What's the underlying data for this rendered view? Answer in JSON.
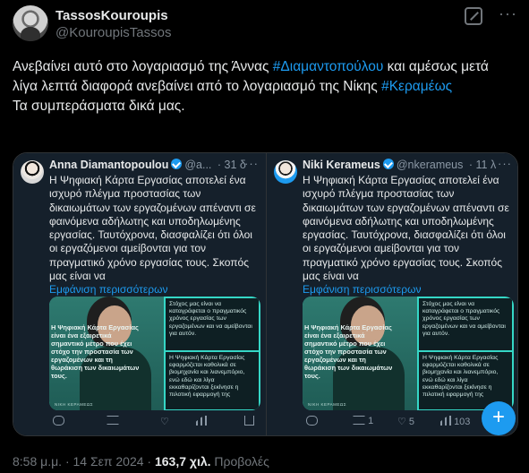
{
  "author": {
    "name": "TassosKouroupis",
    "handle": "@KouroupisTassos"
  },
  "tweet": {
    "text_1": "Ανεβαίνει αυτό στο λογαριασμό της Άννας ",
    "hashtag_1": "#Διαμαντοπούλου",
    "text_2": " και αμέσως μετά λίγα λεπτά διαφορά ανεβαίνει από το λογαριασμό της Νίκης ",
    "hashtag_2": "#Κεραμέως",
    "text_3": "Τα συμπεράσματα δικά μας."
  },
  "cards": [
    {
      "name": "Anna Diamantopoulou",
      "handle": "@a...",
      "time": "· 31 δ",
      "text": "Η Ψηφιακή Κάρτα Εργασίας αποτελεί ένα ισχυρό πλέγμα προστασίας των δικαιωμάτων των εργαζομένων απέναντι σε φαινόμενα αδήλωτης και υποδηλωμένης εργασίας. Ταυτόχρονα, διασφαλίζει ότι όλοι οι εργαζόμενοι αμείβονται για τον πραγματικό χρόνο εργασίας τους. Σκοπός μας είναι να",
      "show_more": "Εμφάνιση περισσότερων",
      "poster_overlay": "Η Ψηφιακή Κάρτα Εργασίας είναι ένα εξαιρετικά σημαντικό μέτρο που έχει στόχο την προστασία των εργαζομένων και τη θωράκιση των δικαιωμάτων τους.",
      "poster_foot": "ΝΙΚΗ ΚΕΡΑΜΕΩΣ",
      "panel_1": "Στόχος μας είναι να καταγράφεται ο πραγματικός χρόνος εργασίας των εργαζομένων και να αμείβονται για αυτόν.",
      "panel_2": "Η Ψηφιακή Κάρτα Εργασίας εφαρμόζεται καθολικά σε βιομηχανία και λιανεμπόριο, ενώ εδώ και λίγα εκκαθαρίζονται ξεκίνησε η πιλοτική εφαρμογή της",
      "reply_count": "",
      "retweet_count": "",
      "like_count": "",
      "views_count": ""
    },
    {
      "name": "Niki Kerameus",
      "handle": "@nkerameus",
      "time": "· 11 λ",
      "text": "Η Ψηφιακή Κάρτα Εργασίας αποτελεί ένα ισχυρό πλέγμα προστασίας των δικαιωμάτων των εργαζομένων απέναντι σε φαινόμενα αδήλωτης και υποδηλωμένης εργασίας. Ταυτόχρονα, διασφαλίζει ότι όλοι οι εργαζόμενοι αμείβονται για τον πραγματικό χρόνο εργασίας τους. Σκοπός μας είναι να",
      "show_more": "Εμφάνιση περισσότερων",
      "poster_overlay": "Η Ψηφιακή Κάρτα Εργασίας είναι ένα εξαιρετικά σημαντικό μέτρο που έχει στόχο την προστασία των εργαζομένων και τη θωράκιση των δικαιωμάτων τους.",
      "poster_foot": "ΝΙΚΗ ΚΕΡΑΜΕΩΣ",
      "panel_1": "Στόχος μας είναι να καταγράφεται ο πραγματικός χρόνος εργασίας των εργαζομένων και να αμείβονται για αυτόν.",
      "panel_2": "Η Ψηφιακή Κάρτα Εργασίας εφαρμόζεται καθολικά σε βιομηχανία και λιανεμπόριο, ενώ εδώ και λίγα εκκαθαρίζονται ξεκίνησε η πιλοτική εφαρμογή της",
      "reply_count": "",
      "retweet_count": "1",
      "like_count": "5",
      "views_count": "103"
    }
  ],
  "meta": {
    "time": "8:58 μ.μ. · 14 Σεπ 2024 · ",
    "views": "163,7 χιλ.",
    "views_label": " Προβολές"
  },
  "fab_label": "+",
  "colors": {
    "background": "#000000",
    "link": "#1d9bf0",
    "card_bg": "#15202b",
    "poster_teal": "#35d7c6"
  }
}
